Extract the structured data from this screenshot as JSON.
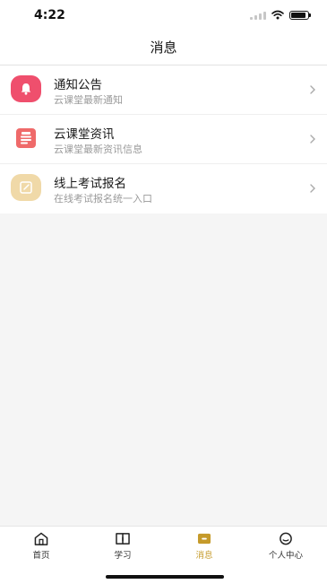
{
  "status_bar": {
    "time": "4:22",
    "battery_level": 0.9
  },
  "nav": {
    "title": "消息"
  },
  "messages": {
    "items": [
      {
        "title": "通知公告",
        "subtitle": "云课堂最新通知",
        "icon": "bell-icon",
        "icon_color": "#ef4f6d"
      },
      {
        "title": "云课堂资讯",
        "subtitle": "云课堂最新资讯信息",
        "icon": "news-icon",
        "icon_color": "#ef6a6a"
      },
      {
        "title": "线上考试报名",
        "subtitle": "在线考试报名统一入口",
        "icon": "edit-icon",
        "icon_color": "#f0d9a8"
      }
    ]
  },
  "tab_bar": {
    "items": [
      {
        "label": "首页",
        "icon": "home-icon"
      },
      {
        "label": "学习",
        "icon": "book-icon"
      },
      {
        "label": "消息",
        "icon": "message-icon",
        "active": true
      },
      {
        "label": "个人中心",
        "icon": "profile-icon"
      }
    ],
    "active_color": "#c59a2a"
  }
}
